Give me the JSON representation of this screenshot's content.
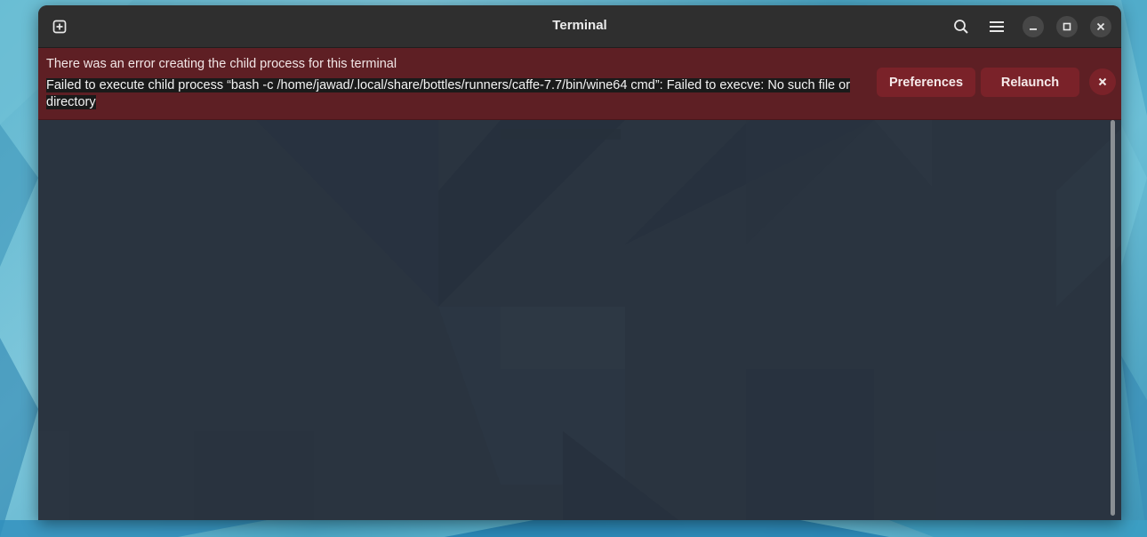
{
  "window": {
    "title": "Terminal"
  },
  "headerbar": {
    "icons": {
      "new_tab": "tab-new-icon",
      "search": "search-icon",
      "menu": "hamburger-menu-icon",
      "minimize": "minimize-icon",
      "maximize": "maximize-icon",
      "close": "close-icon"
    }
  },
  "infobar": {
    "title": "There was an error creating the child process for this terminal",
    "detail": "Failed to execute child process “bash -c /home/jawad/.local/share/bottles/runners/caffe-7.7/bin/wine64 cmd”: Failed to execve: No such file or directory",
    "preferences_label": "Preferences",
    "relaunch_label": "Relaunch",
    "close_icon": "close-icon"
  },
  "colors": {
    "headerbar": "#2f2f2f",
    "infobar_error": "#5e1f24",
    "infobar_button": "#7a2229",
    "terminal_bg": "#2a3440"
  }
}
